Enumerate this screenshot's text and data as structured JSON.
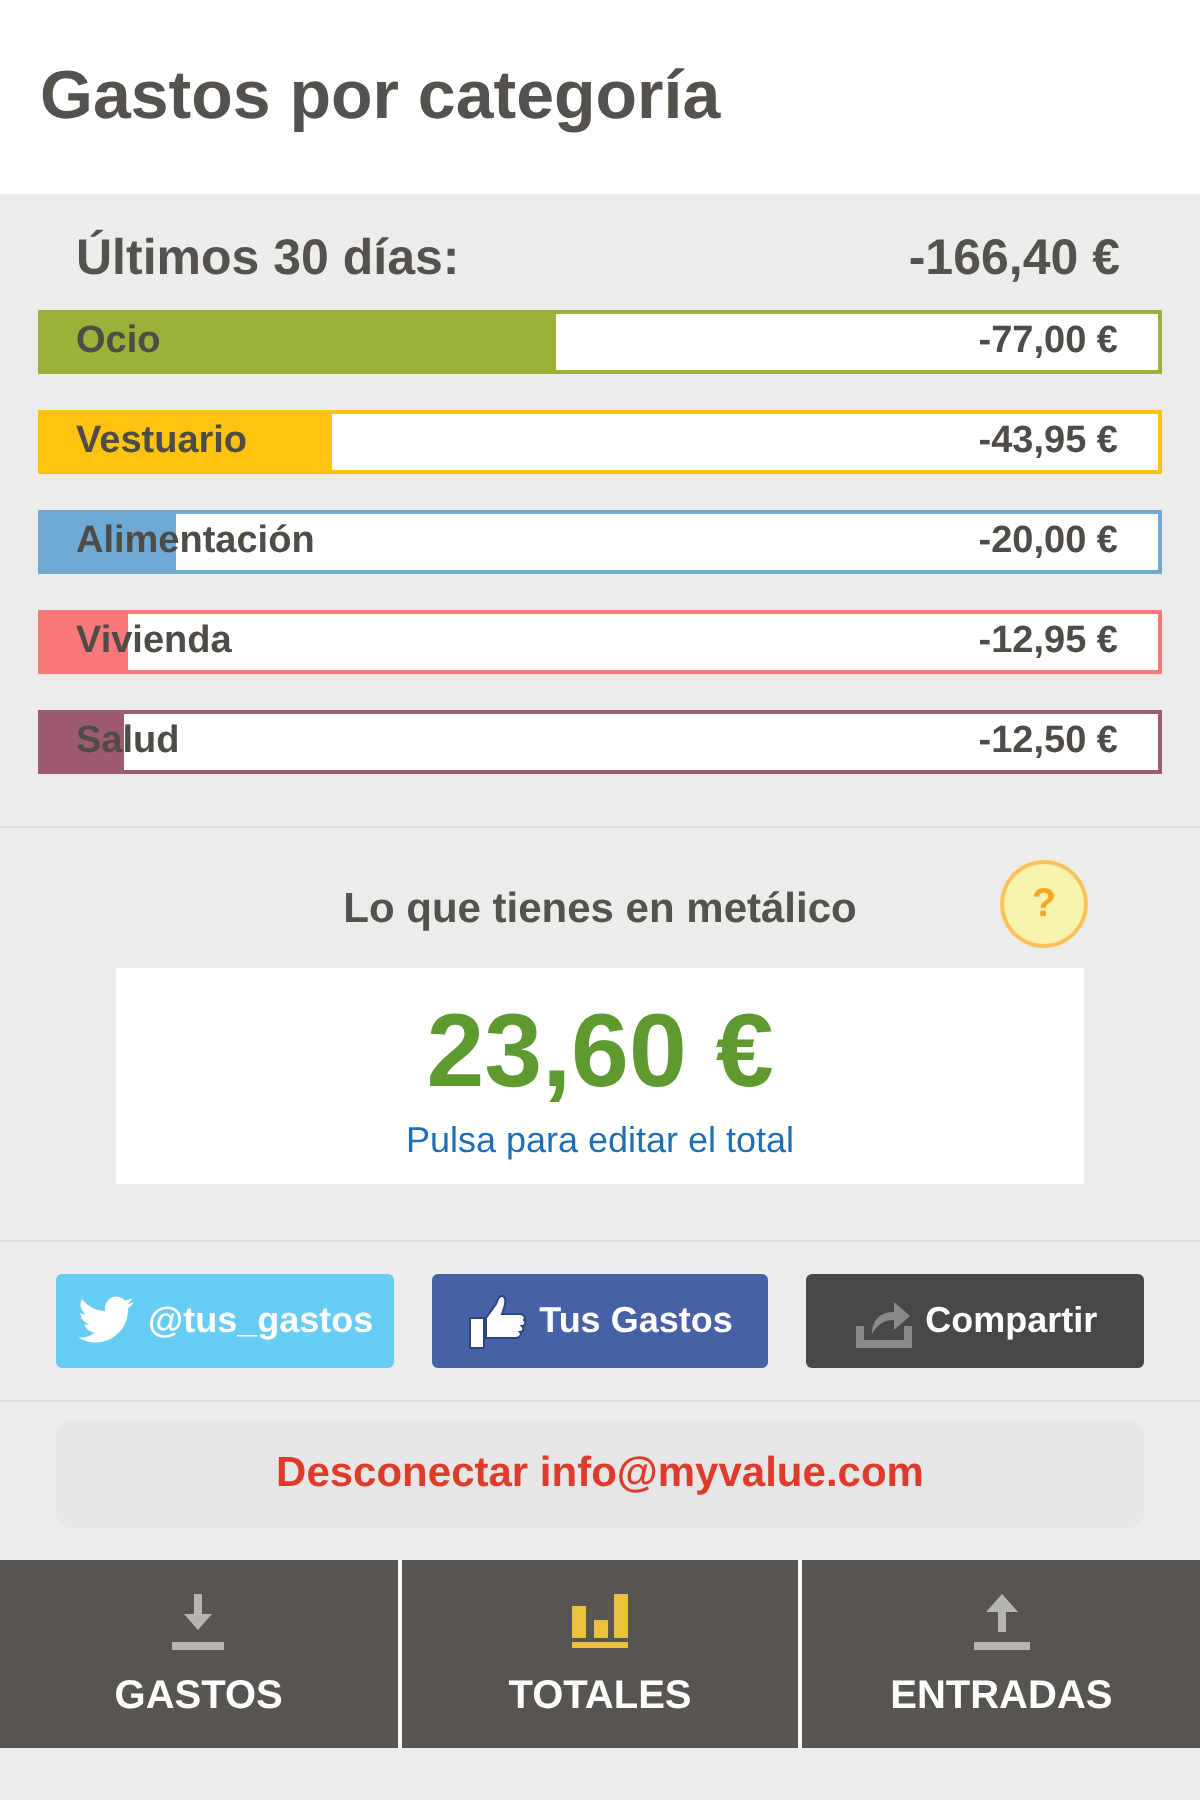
{
  "header": {
    "title": "Gastos por categoría"
  },
  "summary": {
    "label": "Últimos 30 días:",
    "total": "-166,40 €"
  },
  "categories": [
    {
      "name": "Ocio",
      "amount": "-77,00 €",
      "level": 0.46,
      "color": "#9ab13a"
    },
    {
      "name": "Vestuario",
      "amount": "-43,95 €",
      "level": 0.26,
      "color": "#fdc30f"
    },
    {
      "name": "Alimentación",
      "amount": "-20,00 €",
      "level": 0.12,
      "color": "#6faad4"
    },
    {
      "name": "Vivienda",
      "amount": "-12,95 €",
      "level": 0.077,
      "color": "#f77878"
    },
    {
      "name": "Salud",
      "amount": "-12,50 €",
      "level": 0.073,
      "color": "#9d5a70"
    }
  ],
  "cash": {
    "label": "Lo que tienes en metálico",
    "help": "?",
    "amount": "23,60 €",
    "edit_link": "Pulsa para editar el total"
  },
  "social_buttons": [
    {
      "kind": "twitter",
      "label": "@tus_gastos"
    },
    {
      "kind": "facebook",
      "label": "Tus Gastos"
    },
    {
      "kind": "share",
      "label": "Compartir"
    }
  ],
  "disconnect": {
    "label": "Desconectar info@myvalue.com"
  },
  "tabs": [
    {
      "kind": "download",
      "label": "GASTOS",
      "selected": false
    },
    {
      "kind": "chart",
      "label": "TOTALES",
      "selected": true
    },
    {
      "kind": "upload",
      "label": "ENTRADAS",
      "selected": false
    }
  ]
}
